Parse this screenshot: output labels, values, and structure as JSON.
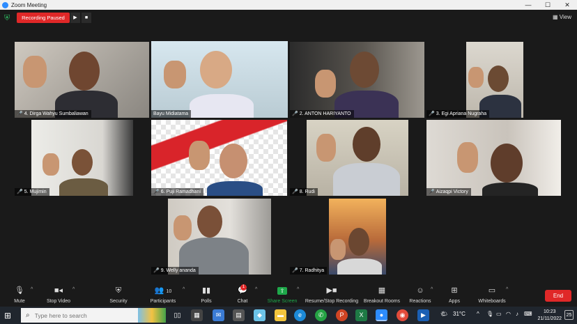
{
  "window": {
    "title": "Zoom Meeting",
    "controls": [
      "—",
      "☐",
      "✕"
    ]
  },
  "topbar": {
    "recording_status": "Recording Paused",
    "view_label": "View"
  },
  "participants": [
    {
      "name": "4. Dirga Wahyu Sumbaliawan",
      "muted": true
    },
    {
      "name": "Bayu Midiatama",
      "muted": false,
      "active_speaker": true
    },
    {
      "name": "2. ANTON HARIYANTO",
      "muted": true
    },
    {
      "name": "3. Egi Apriana Nugraha",
      "muted": true
    },
    {
      "name": "5. Mujimin",
      "muted": true
    },
    {
      "name": "6. Puji Ramadhani",
      "muted": true
    },
    {
      "name": "8. Rudi",
      "muted": true
    },
    {
      "name": "Aizaqpi Victory",
      "muted": true
    },
    {
      "name": "9. Welly ananda",
      "muted": true
    },
    {
      "name": "7. Radhitya",
      "muted": true
    }
  ],
  "toolbar": {
    "mute": "Mute",
    "stop_video": "Stop Video",
    "security": "Security",
    "participants": "Participants",
    "participants_count": "10",
    "polls": "Polls",
    "chat": "Chat",
    "chat_badge": "1",
    "share_screen": "Share Screen",
    "recording": "Resume/Stop Recording",
    "breakout": "Breakout Rooms",
    "reactions": "Reactions",
    "apps": "Apps",
    "whiteboards": "Whiteboards",
    "end": "End"
  },
  "taskbar": {
    "search_placeholder": "Type here to search",
    "temperature": "31°C",
    "time": "10:23",
    "date": "21/11/2022",
    "notifications": "25",
    "whatsapp_badge": "1"
  },
  "colors": {
    "accent_red": "#e02828",
    "share_green": "#1ea84a",
    "active_border": "#d9e34a",
    "zoom_blue": "#2d8cff"
  }
}
